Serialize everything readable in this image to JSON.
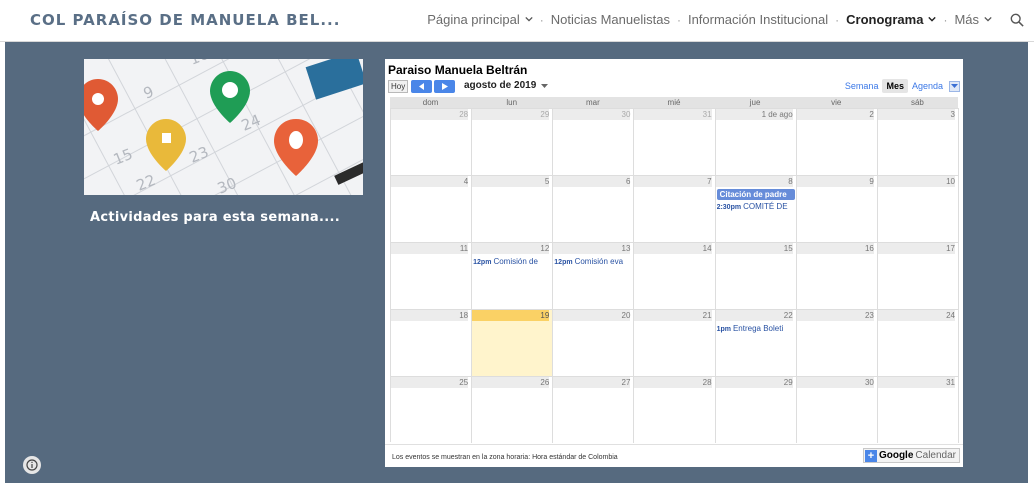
{
  "site": {
    "title": "COL PARAÍSO DE MANUELA BEL..."
  },
  "nav": {
    "items": [
      {
        "label": "Página principal",
        "has_dropdown": true,
        "active": false
      },
      {
        "label": "Noticias Manuelistas",
        "has_dropdown": false,
        "active": false
      },
      {
        "label": "Información Institucional",
        "has_dropdown": false,
        "active": false
      },
      {
        "label": "Cronograma",
        "has_dropdown": true,
        "active": true
      },
      {
        "label": "Más",
        "has_dropdown": true,
        "active": false
      }
    ],
    "separator": "·",
    "search_icon": "search-icon"
  },
  "sidebar": {
    "caption": "Actividades para esta semana...."
  },
  "calendar": {
    "title": "Paraiso Manuela Beltrán",
    "today_button": "Hoy",
    "month_label": "agosto de 2019",
    "views": [
      "Semana",
      "Mes",
      "Agenda"
    ],
    "active_view": "Mes",
    "weekdays": [
      "dom",
      "lun",
      "mar",
      "mié",
      "jue",
      "vie",
      "sáb"
    ],
    "weeks": [
      [
        {
          "n": "28",
          "out": true
        },
        {
          "n": "29",
          "out": true
        },
        {
          "n": "30",
          "out": true
        },
        {
          "n": "31",
          "out": true
        },
        {
          "n": "1 de ago"
        },
        {
          "n": "2"
        },
        {
          "n": "3"
        }
      ],
      [
        {
          "n": "4"
        },
        {
          "n": "5"
        },
        {
          "n": "6"
        },
        {
          "n": "7"
        },
        {
          "n": "8",
          "events": [
            {
              "style": "chip",
              "time": "",
              "text": "Citación de padre"
            },
            {
              "style": "text",
              "time": "2:30pm",
              "text": "COMITÉ DE"
            }
          ]
        },
        {
          "n": "9"
        },
        {
          "n": "10"
        }
      ],
      [
        {
          "n": "11"
        },
        {
          "n": "12",
          "events": [
            {
              "style": "text",
              "time": "12pm",
              "text": "Comisión de"
            }
          ]
        },
        {
          "n": "13",
          "events": [
            {
              "style": "text",
              "time": "12pm",
              "text": "Comisión eva"
            }
          ]
        },
        {
          "n": "14"
        },
        {
          "n": "15"
        },
        {
          "n": "16"
        },
        {
          "n": "17"
        }
      ],
      [
        {
          "n": "18"
        },
        {
          "n": "19",
          "today": true
        },
        {
          "n": "20"
        },
        {
          "n": "21"
        },
        {
          "n": "22",
          "events": [
            {
              "style": "text",
              "time": "1pm",
              "text": "Entrega Boleti"
            }
          ]
        },
        {
          "n": "23"
        },
        {
          "n": "24"
        }
      ],
      [
        {
          "n": "25"
        },
        {
          "n": "26"
        },
        {
          "n": "27"
        },
        {
          "n": "28"
        },
        {
          "n": "29"
        },
        {
          "n": "30"
        },
        {
          "n": "31"
        }
      ]
    ],
    "timezone_note": "Los eventos se muestran en la zona horaria: Hora estándar de Colombia",
    "badge": {
      "plus": "+",
      "google": "Google",
      "calendar": "Calendar"
    }
  },
  "colors": {
    "main_bg": "#566a7f",
    "title_color": "#5a6f86",
    "accent_blue": "#4a86e8",
    "event_chip": "#668cd9",
    "event_text": "#2952a3",
    "today_bg": "#fff4cc",
    "today_header": "#fad165"
  }
}
